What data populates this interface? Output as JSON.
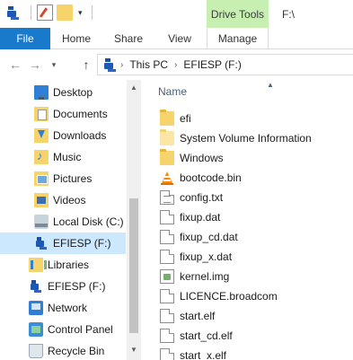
{
  "title_bar": {
    "context_tab_group": "Drive Tools",
    "window_path": "F:\\",
    "qat_dropdown": "▾"
  },
  "ribbon": {
    "tabs": {
      "file": "File",
      "home": "Home",
      "share": "Share",
      "view": "View",
      "manage": "Manage"
    }
  },
  "address_bar": {
    "back_glyph": "←",
    "forward_glyph": "→",
    "recent_glyph": "▾",
    "up_glyph": "↑",
    "separator": "›",
    "crumbs": [
      "This PC",
      "EFIESP (F:)"
    ]
  },
  "nav_pane": {
    "items": [
      {
        "label": "Desktop",
        "icon": "desktop-icon"
      },
      {
        "label": "Documents",
        "icon": "documents-icon"
      },
      {
        "label": "Downloads",
        "icon": "downloads-icon"
      },
      {
        "label": "Music",
        "icon": "music-icon"
      },
      {
        "label": "Pictures",
        "icon": "pictures-icon"
      },
      {
        "label": "Videos",
        "icon": "videos-icon"
      },
      {
        "label": "Local Disk (C:)",
        "icon": "local-disk-icon"
      },
      {
        "label": "EFIESP (F:)",
        "icon": "drive-icon",
        "selected": true
      },
      {
        "label": "Libraries",
        "icon": "libraries-icon"
      },
      {
        "label": "EFIESP (F:)",
        "icon": "drive-icon"
      },
      {
        "label": "Network",
        "icon": "network-icon"
      },
      {
        "label": "Control Panel",
        "icon": "control-panel-icon"
      },
      {
        "label": "Recycle Bin",
        "icon": "recycle-bin-icon"
      }
    ],
    "scroll_up_glyph": "▲",
    "scroll_down_glyph": "▼"
  },
  "file_list": {
    "column_name": "Name",
    "sort_glyph": "▲",
    "files": [
      {
        "name": "efi",
        "icon": "folder-icon"
      },
      {
        "name": "System Volume Information",
        "icon": "folder-icon"
      },
      {
        "name": "Windows",
        "icon": "folder-icon"
      },
      {
        "name": "bootcode.bin",
        "icon": "vlc-icon"
      },
      {
        "name": "config.txt",
        "icon": "text-file-icon"
      },
      {
        "name": "fixup.dat",
        "icon": "file-icon"
      },
      {
        "name": "fixup_cd.dat",
        "icon": "file-icon"
      },
      {
        "name": "fixup_x.dat",
        "icon": "file-icon"
      },
      {
        "name": "kernel.img",
        "icon": "image-file-icon"
      },
      {
        "name": "LICENCE.broadcom",
        "icon": "file-icon"
      },
      {
        "name": "start.elf",
        "icon": "file-icon"
      },
      {
        "name": "start_cd.elf",
        "icon": "file-icon"
      },
      {
        "name": "start_x.elf",
        "icon": "file-icon"
      }
    ]
  },
  "colors": {
    "file_tab": "#1979ca",
    "context_tab": "#c6efb1",
    "selection": "#cce8ff",
    "folder": "#f7d36b"
  }
}
